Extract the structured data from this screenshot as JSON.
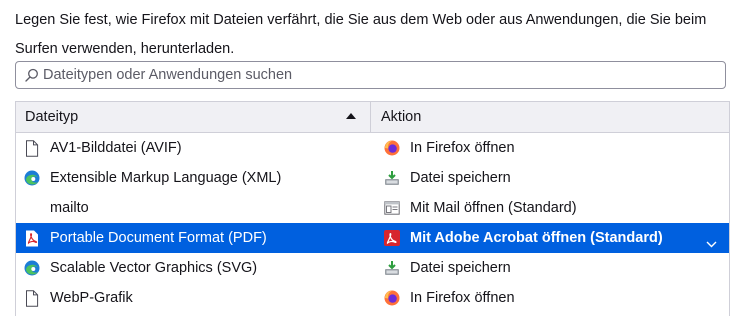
{
  "description": "Legen Sie fest, wie Firefox mit Dateien verfährt, die Sie aus dem Web oder aus Anwendungen, die Sie beim Surfen verwenden, herunterladen.",
  "search": {
    "placeholder": "Dateitypen oder Anwendungen suchen",
    "value": ""
  },
  "table": {
    "columns": {
      "type": "Dateityp",
      "action": "Aktion"
    },
    "rows": [
      {
        "type": "AV1-Bilddatei (AVIF)",
        "type_icon": "generic-file-icon",
        "action": "In Firefox öffnen",
        "action_icon": "firefox-icon"
      },
      {
        "type": "Extensible Markup Language (XML)",
        "type_icon": "edge-icon",
        "action": "Datei speichern",
        "action_icon": "save-file-icon"
      },
      {
        "type": "mailto",
        "type_icon": "none",
        "action": "Mit Mail öffnen (Standard)",
        "action_icon": "mail-app-icon"
      },
      {
        "type": "Portable Document Format (PDF)",
        "type_icon": "pdf-icon",
        "action": "Mit Adobe Acrobat öffnen (Standard)",
        "action_icon": "acrobat-icon",
        "selected": true
      },
      {
        "type": "Scalable Vector Graphics (SVG)",
        "type_icon": "edge-icon",
        "action": "Datei speichern",
        "action_icon": "save-file-icon"
      },
      {
        "type": "WebP-Grafik",
        "type_icon": "generic-file-icon",
        "action": "In Firefox öffnen",
        "action_icon": "firefox-icon"
      }
    ]
  },
  "colors": {
    "selection": "#0060df",
    "header_bg": "#f0f0f4",
    "border": "#cfcfd8"
  }
}
